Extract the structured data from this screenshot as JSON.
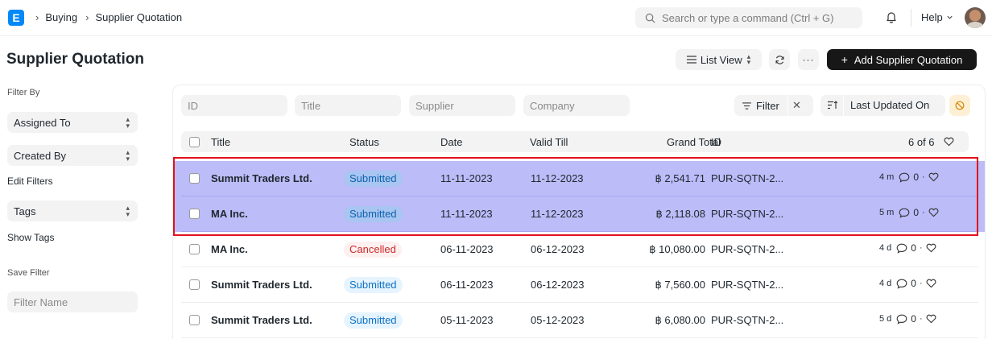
{
  "app": {
    "logo_letter": "E"
  },
  "breadcrumbs": [
    "Buying",
    "Supplier Quotation"
  ],
  "search": {
    "placeholder": "Search or type a command (Ctrl + G)"
  },
  "navbar": {
    "help_label": "Help"
  },
  "page": {
    "title": "Supplier Quotation"
  },
  "toolbar": {
    "list_view_label": "List View",
    "more_label": "···",
    "add_label": "Add Supplier Quotation"
  },
  "sidebar": {
    "filter_by_label": "Filter By",
    "assigned_to_label": "Assigned To",
    "created_by_label": "Created By",
    "edit_filters_label": "Edit Filters",
    "tags_label": "Tags",
    "show_tags_label": "Show Tags",
    "save_filter_label": "Save Filter",
    "filter_name_placeholder": "Filter Name"
  },
  "filters": {
    "id_placeholder": "ID",
    "title_placeholder": "Title",
    "supplier_placeholder": "Supplier",
    "company_placeholder": "Company",
    "filter_label": "Filter",
    "sort_label": "Last Updated On"
  },
  "table": {
    "columns": {
      "title": "Title",
      "status": "Status",
      "date": "Date",
      "valid_till": "Valid Till",
      "grand_total": "Grand Total",
      "id": "ID"
    },
    "count_label": "6 of 6",
    "rows": [
      {
        "title": "Summit Traders Ltd.",
        "status": "Submitted",
        "date": "11-11-2023",
        "valid_till": "11-12-2023",
        "grand_total": "฿ 2,541.71",
        "id": "PUR-SQTN-2...",
        "modified": "4 m",
        "comments": "0",
        "selected": true
      },
      {
        "title": "MA Inc.",
        "status": "Submitted",
        "date": "11-11-2023",
        "valid_till": "11-12-2023",
        "grand_total": "฿ 2,118.08",
        "id": "PUR-SQTN-2...",
        "modified": "5 m",
        "comments": "0",
        "selected": true
      },
      {
        "title": "MA Inc.",
        "status": "Cancelled",
        "date": "06-11-2023",
        "valid_till": "06-12-2023",
        "grand_total": "฿ 10,080.00",
        "id": "PUR-SQTN-2...",
        "modified": "4 d",
        "comments": "0",
        "selected": false
      },
      {
        "title": "Summit Traders Ltd.",
        "status": "Submitted",
        "date": "06-11-2023",
        "valid_till": "06-12-2023",
        "grand_total": "฿ 7,560.00",
        "id": "PUR-SQTN-2...",
        "modified": "4 d",
        "comments": "0",
        "selected": false
      },
      {
        "title": "Summit Traders Ltd.",
        "status": "Submitted",
        "date": "05-11-2023",
        "valid_till": "05-12-2023",
        "grand_total": "฿ 6,080.00",
        "id": "PUR-SQTN-2...",
        "modified": "5 d",
        "comments": "0",
        "selected": false
      }
    ]
  },
  "colors": {
    "brand": "#0289f7",
    "selection": "#bbbcf8",
    "highlight_border": "#e3101c",
    "primary_button": "#171717"
  }
}
